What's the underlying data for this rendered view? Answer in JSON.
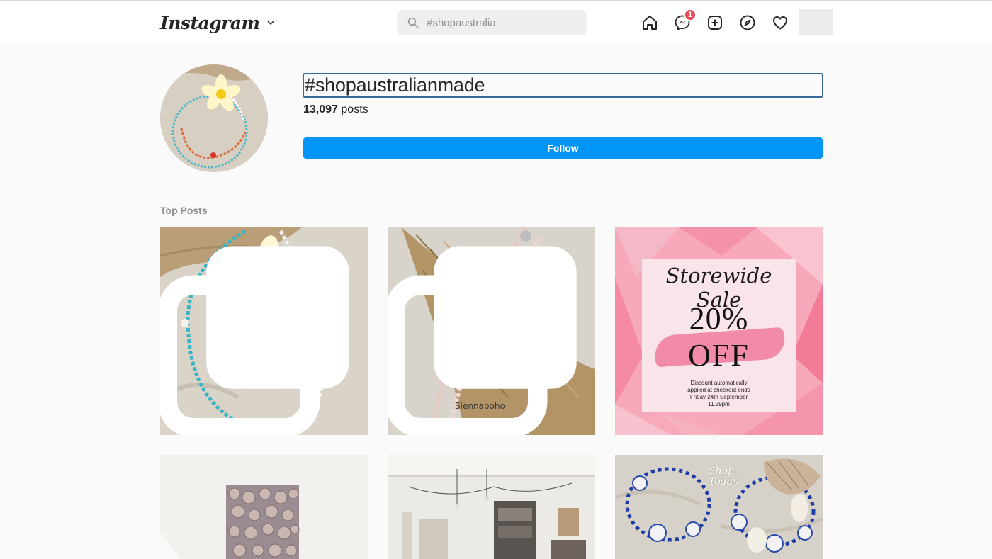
{
  "app": {
    "logo_text": "Instagram"
  },
  "search": {
    "placeholder": "#shopaustralia",
    "value": ""
  },
  "nav": {
    "icons": [
      "home-icon",
      "messenger-icon",
      "new-post-icon",
      "explore-icon",
      "activity-heart-icon"
    ],
    "messenger_badge": "1"
  },
  "hashtag": {
    "title": "#shopaustralianmade",
    "post_count": "13,097",
    "post_count_suffix": "posts",
    "follow_label": "Follow"
  },
  "sections": {
    "top_posts_label": "Top Posts"
  },
  "posts": [
    {
      "subject": "beaded necklace with frangipani flower",
      "multi": true
    },
    {
      "subject": "beaded tassel bracelet on palm fibre",
      "multi": true,
      "watermark": "Siennaboho"
    },
    {
      "subject": "storewide sale promo",
      "sale_title": "Storewide Sale",
      "sale_percent": "20%",
      "sale_off": "OFF",
      "sale_lines": [
        "Discount automatically",
        "applied at checkout ends",
        "Friday 24th September",
        "11.59pm"
      ]
    },
    {
      "subject": "framed seashell artwork on wall"
    },
    {
      "subject": "boutique shop interior"
    },
    {
      "subject": "blue and white beaded bracelets with shells",
      "overlay_text": [
        "Shop",
        "Today"
      ]
    }
  ],
  "colors": {
    "accent": "#0095f6",
    "badge": "#ed4956",
    "sale_bg": "#f7a8bb",
    "muted_text": "#8e8e8e"
  }
}
